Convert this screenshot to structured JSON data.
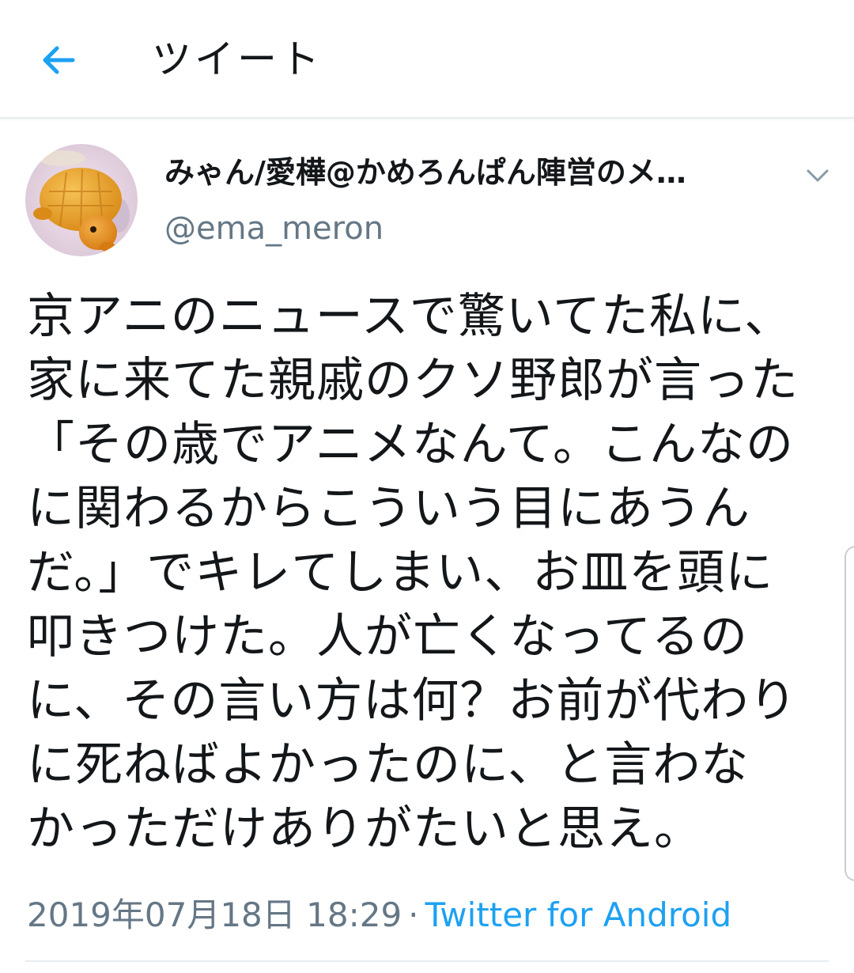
{
  "header": {
    "title": "ツイート",
    "back_icon": "arrow-left-icon",
    "accent_color": "#1da1f2"
  },
  "tweet": {
    "author": {
      "display_name": "みゃん/愛樺@かめろんぱん陣営のメ…",
      "handle": "@ema_meron",
      "avatar_icon": "turtle-melonpan-avatar"
    },
    "text_lines": [
      "京アニのニュースで驚いてた私に、",
      "家に来てた親戚のクソ野郎が言った",
      "「その歳でアニメなんて。こんなの",
      "に関わるからこういう目にあうん",
      "だ。」でキレてしまい、お皿を頭に",
      "叩きつけた。人が亡くなってるの",
      "に、その言い方は何？お前が代わり",
      "に死ねばよかったのに、と言わな",
      "かっただけありがたいと思え。"
    ],
    "timestamp": "2019年07月18日 18:29",
    "separator": "·",
    "source": "Twitter for Android"
  },
  "colors": {
    "text": "#14171a",
    "secondary": "#657786",
    "link": "#1da1f2",
    "divider": "#e6ecf0"
  }
}
